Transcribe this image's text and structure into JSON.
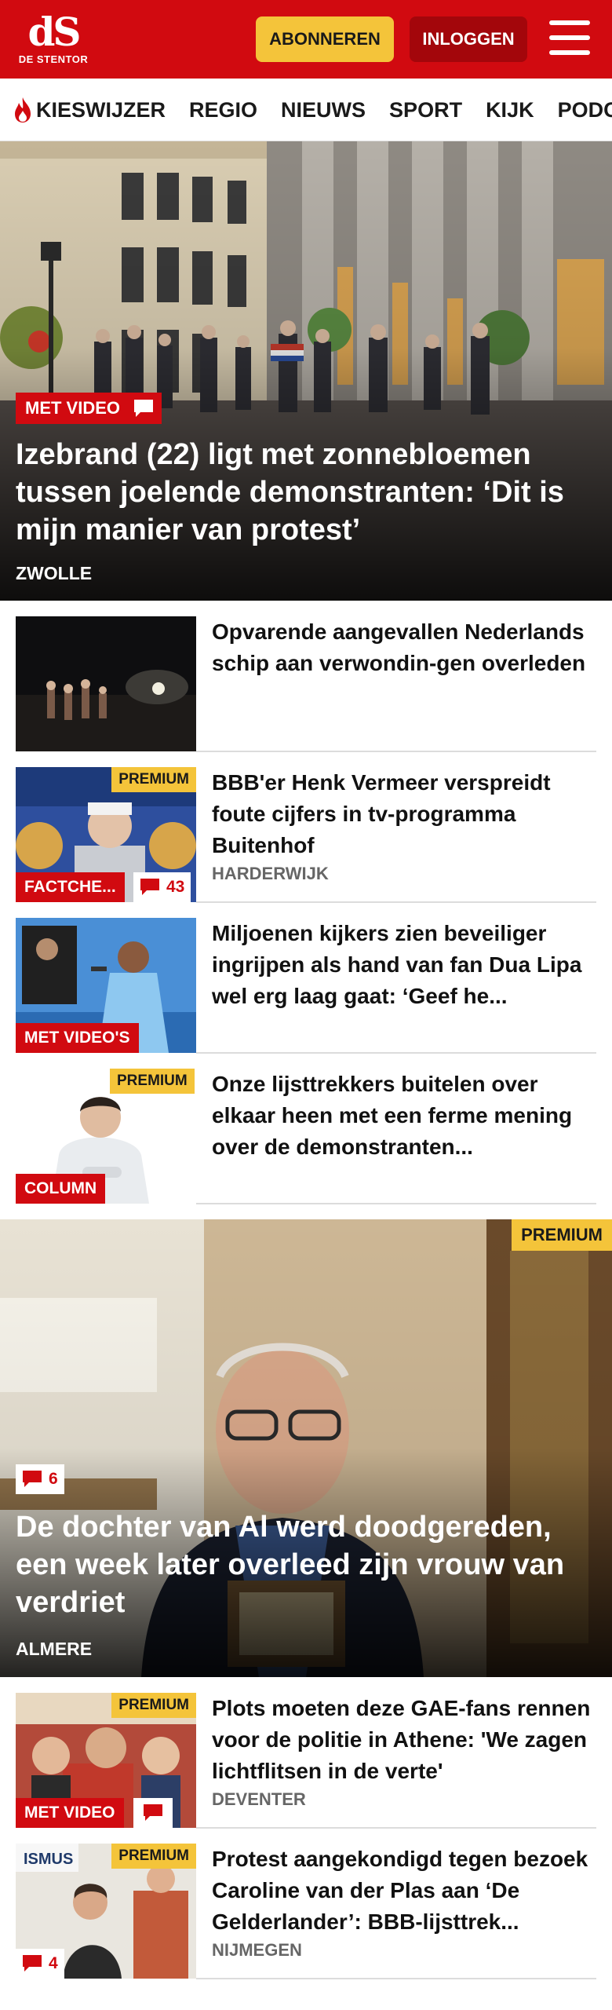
{
  "header": {
    "logo_mark": "dS",
    "logo_sub": "DE STENTOR",
    "subscribe_label": "ABONNEREN",
    "login_label": "INLOGGEN",
    "menu_icon": "hamburger-menu-icon",
    "brand_color": "#d10a10",
    "accent_color": "#f4c43a"
  },
  "nav": {
    "items": [
      {
        "label": "KIESWIJZER",
        "icon": "flame-icon"
      },
      {
        "label": "REGIO"
      },
      {
        "label": "NIEUWS"
      },
      {
        "label": "SPORT"
      },
      {
        "label": "KIJK"
      },
      {
        "label": "PODCAS"
      }
    ]
  },
  "hero": {
    "tag": "MET VIDEO",
    "title": "Izebrand (22) ligt met zonnebloemen tussen joelende demonstranten: ‘Dit is mijn manier van protest’",
    "location": "ZWOLLE"
  },
  "articles": [
    {
      "title": "Opvarende aangevallen Nederlands schip aan verwondin-gen overleden"
    },
    {
      "premium": "PREMIUM",
      "tag": "FACTCHE...",
      "comments": "43",
      "title": "BBB'er Henk Vermeer verspreidt foute cijfers in tv-programma Buitenhof",
      "location": "HARDERWIJK"
    },
    {
      "tag": "MET VIDEO'S",
      "title": "Miljoenen kijkers zien beveiliger ingrijpen als hand van fan Dua Lipa wel erg laag gaat: ‘Geef he..."
    },
    {
      "premium": "PREMIUM",
      "tag": "COLUMN",
      "title": "Onze lijsttrekkers buitelen over elkaar heen met een ferme mening over de demonstranten..."
    }
  ],
  "hero2": {
    "premium": "PREMIUM",
    "comments": "6",
    "title": "De dochter van Al werd doodgereden, een week later overleed zijn vrouw van verdriet",
    "location": "ALMERE"
  },
  "articles2": [
    {
      "premium": "PREMIUM",
      "tag": "MET VIDEO",
      "title": "Plots moeten deze GAE-fans rennen voor de politie in Athene: 'We zagen lichtflitsen in de verte'",
      "location": "DEVENTER"
    },
    {
      "premium": "PREMIUM",
      "comments": "4",
      "title": "Protest aangekondigd tegen bezoek Caroline van der Plas aan ‘De Gelderlander’: BBB-lijsttrek...",
      "location": "NIJMEGEN"
    }
  ]
}
